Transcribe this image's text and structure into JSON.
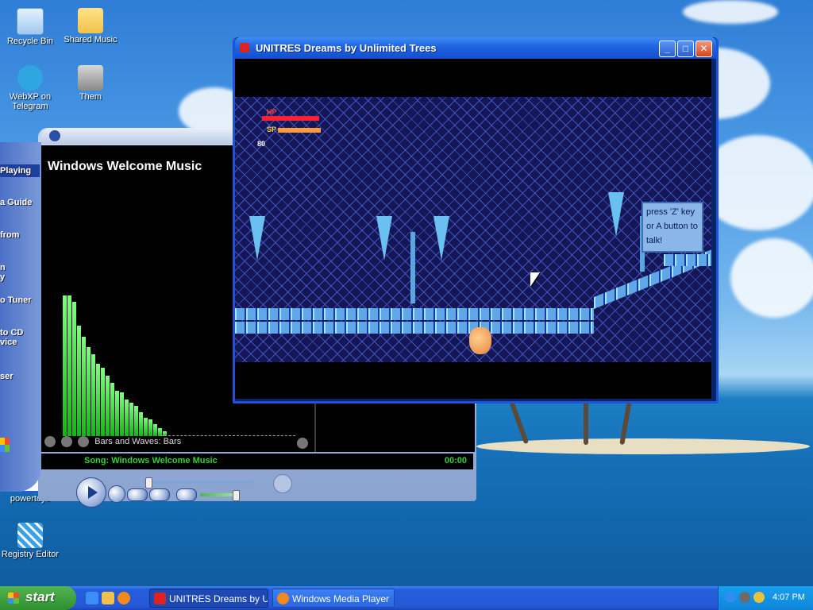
{
  "desktop": {
    "icons": [
      {
        "label": "Recycle Bin"
      },
      {
        "label": "Shared Music"
      },
      {
        "label": "WebXP on Telegram"
      },
      {
        "label": "Them"
      },
      {
        "label": "powertoys"
      },
      {
        "label": "Registry Editor"
      }
    ]
  },
  "wmp": {
    "taskpane": [
      {
        "label": "Playing"
      },
      {
        "label": "a Guide"
      },
      {
        "label": "from"
      },
      {
        "label": "n\ny"
      },
      {
        "label": "o Tuner"
      },
      {
        "label": "to CD\nvice"
      },
      {
        "label": "ser"
      }
    ],
    "video_title": "Windows Welcome Music",
    "visualization_name": "Bars and Waves: Bars",
    "song": "Song: Windows Welcome Music",
    "time": "00:00",
    "seek_fraction": 0.02,
    "volume_fraction": 0.85,
    "viz_levels": [
      0.93,
      0.93,
      0.89,
      0.73,
      0.66,
      0.59,
      0.54,
      0.48,
      0.45,
      0.4,
      0.35,
      0.3,
      0.29,
      0.24,
      0.22,
      0.2,
      0.16,
      0.12,
      0.11,
      0.08,
      0.05,
      0.03
    ]
  },
  "game": {
    "title": "UNITRES Dreams by Unlimited Trees",
    "buttons": {
      "minimize": "_",
      "maximize": "□",
      "close": "✕"
    },
    "hud": {
      "hp": "HP",
      "sp": "SP",
      "count": "80"
    },
    "sign_text": "press 'Z' key or A button to talk!"
  },
  "taskbar": {
    "start": "start",
    "tasks": [
      {
        "label": "UNITRES Dreams by Unl..."
      },
      {
        "label": "Windows Media Player"
      }
    ],
    "clock": "4:07 PM"
  },
  "colors": {
    "xp_blue": "#245edb",
    "start_green": "#2e8f2e",
    "wmp_green_text": "#30d430",
    "viz_green": "#11b811"
  }
}
